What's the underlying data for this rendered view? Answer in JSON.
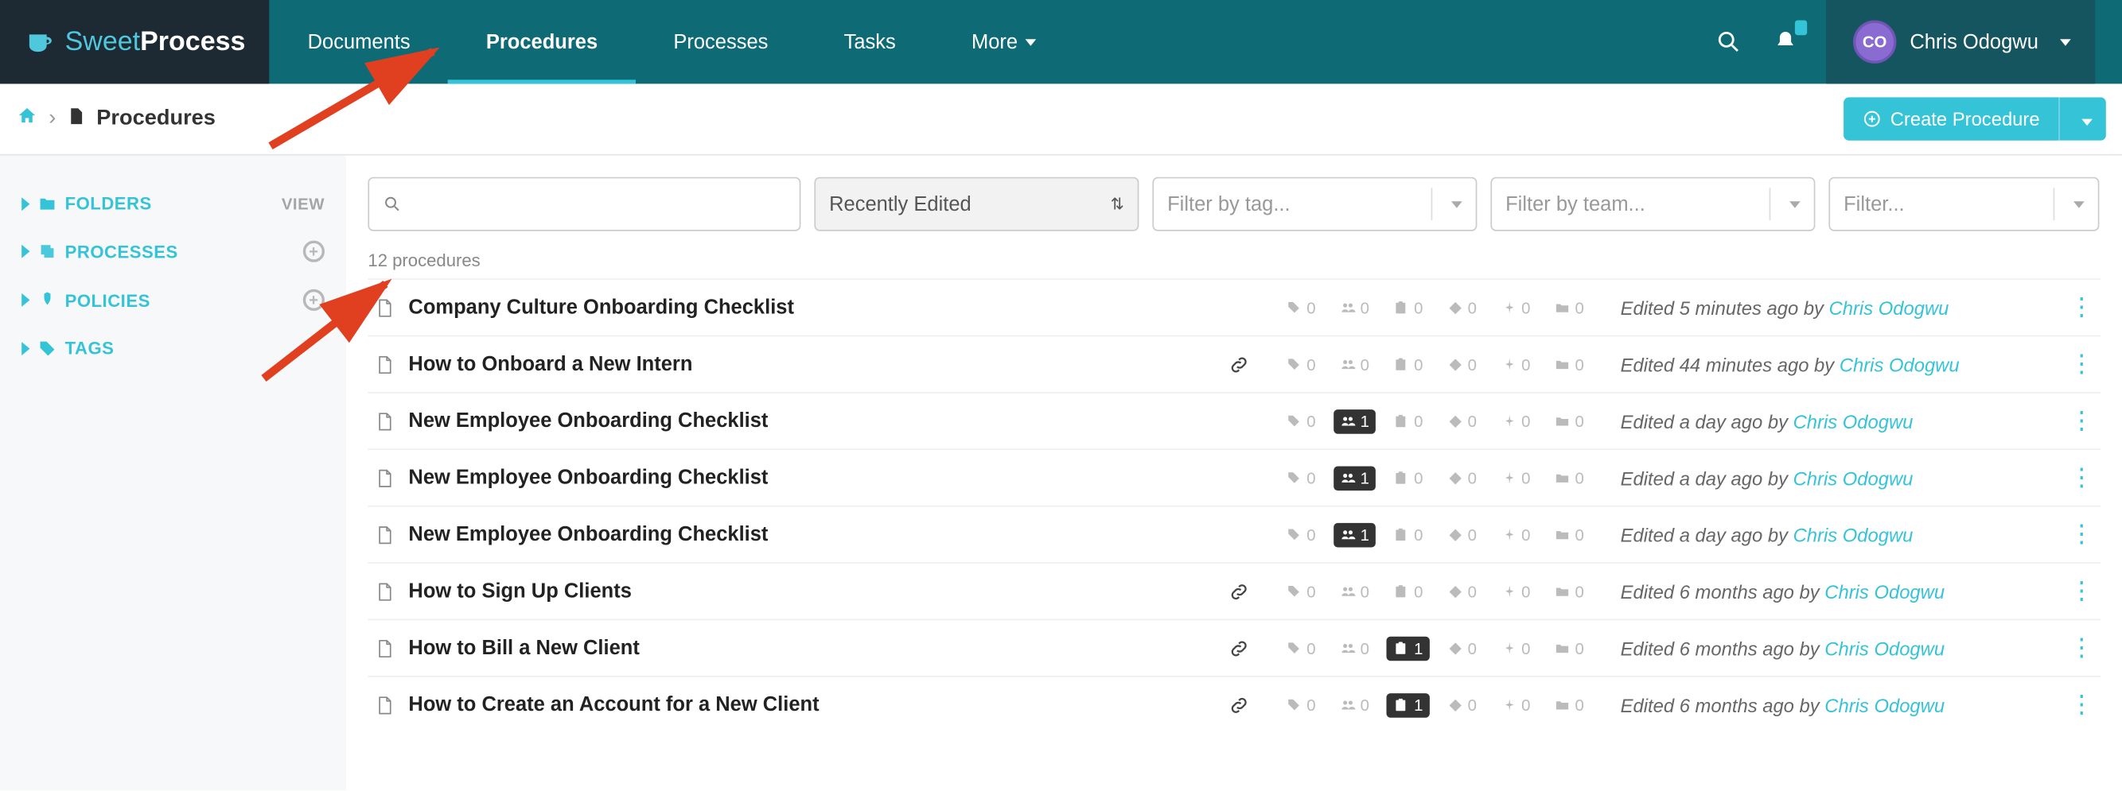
{
  "brand": {
    "part1": "Sweet",
    "part2": "Process"
  },
  "nav": {
    "items": [
      "Documents",
      "Procedures",
      "Processes",
      "Tasks",
      "More"
    ],
    "active_index": 1
  },
  "user": {
    "initials": "CO",
    "name": "Chris Odogwu"
  },
  "breadcrumb": {
    "title": "Procedures"
  },
  "create_btn": {
    "label": "Create Procedure"
  },
  "sidebar": {
    "items": [
      {
        "label": "FOLDERS",
        "right": "VIEW"
      },
      {
        "label": "PROCESSES",
        "right": "plus"
      },
      {
        "label": "POLICIES",
        "right": "plus"
      },
      {
        "label": "TAGS",
        "right": ""
      }
    ]
  },
  "filters": {
    "search_placeholder": "",
    "sort": "Recently Edited",
    "tag_placeholder": "Filter by tag...",
    "team_placeholder": "Filter by team...",
    "filter_placeholder": "Filter..."
  },
  "count_text": "12 procedures",
  "rows": [
    {
      "title": "Company Culture Onboarding Checklist",
      "bold": true,
      "link": false,
      "stats": {
        "tag": 0,
        "team": 0,
        "task": 0,
        "dia": 0,
        "pin": 0,
        "fold": 0,
        "team_hi": false,
        "task_hi": false
      },
      "edited": "Edited 5 minutes ago by",
      "author": "Chris Odogwu"
    },
    {
      "title": "How to Onboard a New Intern",
      "bold": true,
      "link": true,
      "stats": {
        "tag": 0,
        "team": 0,
        "task": 0,
        "dia": 0,
        "pin": 0,
        "fold": 0,
        "team_hi": false,
        "task_hi": false
      },
      "edited": "Edited 44 minutes ago by",
      "author": "Chris Odogwu"
    },
    {
      "title": "New Employee Onboarding Checklist",
      "bold": true,
      "link": false,
      "stats": {
        "tag": 0,
        "team": 1,
        "task": 0,
        "dia": 0,
        "pin": 0,
        "fold": 0,
        "team_hi": true,
        "task_hi": false
      },
      "edited": "Edited a day ago by",
      "author": "Chris Odogwu"
    },
    {
      "title": "New Employee Onboarding Checklist",
      "bold": true,
      "link": false,
      "stats": {
        "tag": 0,
        "team": 1,
        "task": 0,
        "dia": 0,
        "pin": 0,
        "fold": 0,
        "team_hi": true,
        "task_hi": false
      },
      "edited": "Edited a day ago by",
      "author": "Chris Odogwu"
    },
    {
      "title": "New Employee Onboarding Checklist",
      "bold": true,
      "link": false,
      "stats": {
        "tag": 0,
        "team": 1,
        "task": 0,
        "dia": 0,
        "pin": 0,
        "fold": 0,
        "team_hi": true,
        "task_hi": false
      },
      "edited": "Edited a day ago by",
      "author": "Chris Odogwu"
    },
    {
      "title": "How to Sign Up Clients",
      "bold": true,
      "link": true,
      "stats": {
        "tag": 0,
        "team": 0,
        "task": 0,
        "dia": 0,
        "pin": 0,
        "fold": 0,
        "team_hi": false,
        "task_hi": false
      },
      "edited": "Edited 6 months ago by",
      "author": "Chris Odogwu"
    },
    {
      "title": "How to Bill a New Client",
      "bold": true,
      "link": true,
      "stats": {
        "tag": 0,
        "team": 0,
        "task": 1,
        "dia": 0,
        "pin": 0,
        "fold": 0,
        "team_hi": false,
        "task_hi": true
      },
      "edited": "Edited 6 months ago by",
      "author": "Chris Odogwu"
    },
    {
      "title": "How to Create an Account for a New Client",
      "bold": true,
      "link": true,
      "stats": {
        "tag": 0,
        "team": 0,
        "task": 1,
        "dia": 0,
        "pin": 0,
        "fold": 0,
        "team_hi": false,
        "task_hi": true
      },
      "edited": "Edited 6 months ago by",
      "author": "Chris Odogwu"
    }
  ]
}
